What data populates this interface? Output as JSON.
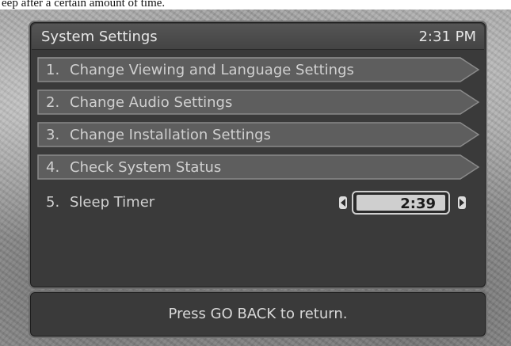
{
  "caption": {
    "text": "eep after a certain amount of time."
  },
  "header": {
    "title": "System Settings",
    "clock": "2:31 PM"
  },
  "menu": {
    "items": [
      {
        "num": "1.",
        "label": "Change Viewing and Language Settings"
      },
      {
        "num": "2.",
        "label": "Change Audio Settings"
      },
      {
        "num": "3.",
        "label": "Change Installation Settings"
      },
      {
        "num": "4.",
        "label": "Check System Status"
      }
    ],
    "sleep": {
      "num": "5.",
      "label": "Sleep Timer",
      "value": "2:39"
    }
  },
  "footer": {
    "text": "Press GO BACK to return."
  },
  "icons": {
    "menu_arrow": "chevron-right-icon",
    "decrease": "arrow-left-icon",
    "increase": "arrow-right-icon"
  },
  "colors": {
    "panel": "#3a3a3a",
    "item": "#5e5e5e",
    "text": "#d0d0d0",
    "timer": "#cfcfcf"
  }
}
